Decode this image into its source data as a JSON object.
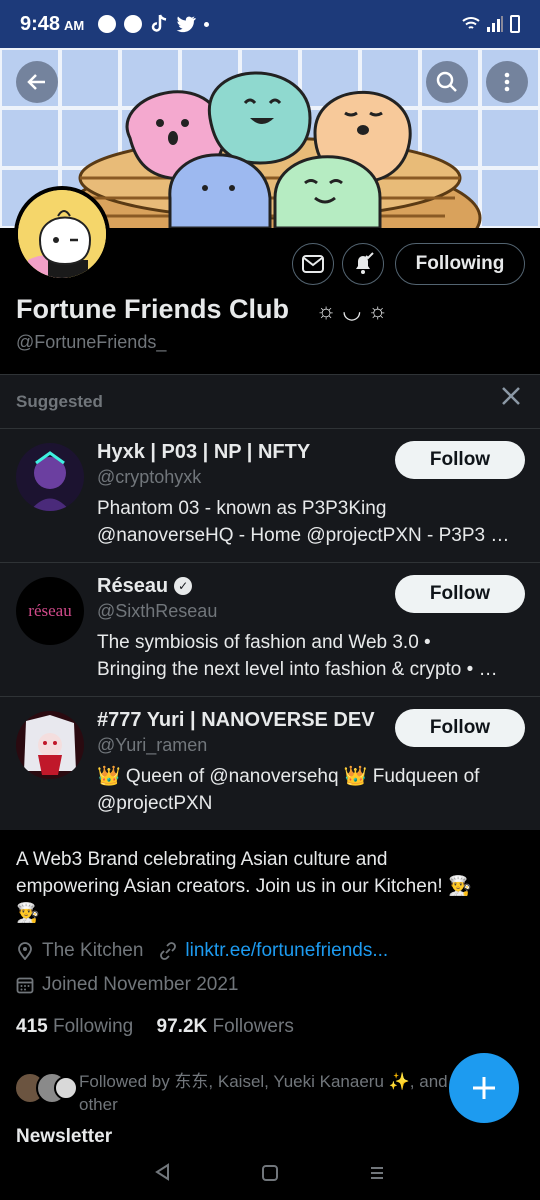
{
  "status_bar": {
    "time": "9:48",
    "ampm": "AM"
  },
  "profile": {
    "display_name": "Fortune Friends Club",
    "name_suffix": "☼ ◡ ☼",
    "handle": "@FortuneFriends_",
    "following_button": "Following",
    "bio_line1": "A Web3 Brand celebrating Asian culture and",
    "bio_line2": "empowering Asian creators.  Join us in our Kitchen! 👨‍🍳",
    "bio_line3": "👨‍🍳",
    "location": "The Kitchen",
    "link": "linktr.ee/fortunefriends...",
    "joined": "Joined November 2021",
    "following_count": "415",
    "following_label": "Following",
    "followers_count": "97.2K",
    "followers_label": "Followers",
    "followed_by_line1": "Followed by 东东, Kaisel, Yueki Kanaeru ✨, and",
    "followed_by_line2": "other",
    "newsletter": "Newsletter"
  },
  "suggested": {
    "heading": "Suggested",
    "follow_label": "Follow",
    "items": [
      {
        "name": "Hyxk | P03 | NP | NFTY",
        "handle": "@cryptohyxk",
        "bio1": "Phantom 03 - known as P3P3King",
        "bio2": "@nanoverseHQ - Home @projectPXN - P3P3 …"
      },
      {
        "name": "Réseau",
        "handle": "@SixthReseau",
        "bio1": "The symbiosis of fashion and Web 3.0 •",
        "bio2": "Bringing the next level into fashion & crypto • …"
      },
      {
        "name": "#777 Yuri | NANOVERSE DEV",
        "handle": "@Yuri_ramen",
        "bio1": "👑 Queen of @nanoversehq  👑 Fudqueen of",
        "bio2": "@projectPXN"
      }
    ]
  },
  "avatar_logo_text": "réseau",
  "colors": {
    "accent": "#1d9bf0",
    "status_bar": "#1d3a7a",
    "background": "#000000",
    "card": "#16181c"
  }
}
